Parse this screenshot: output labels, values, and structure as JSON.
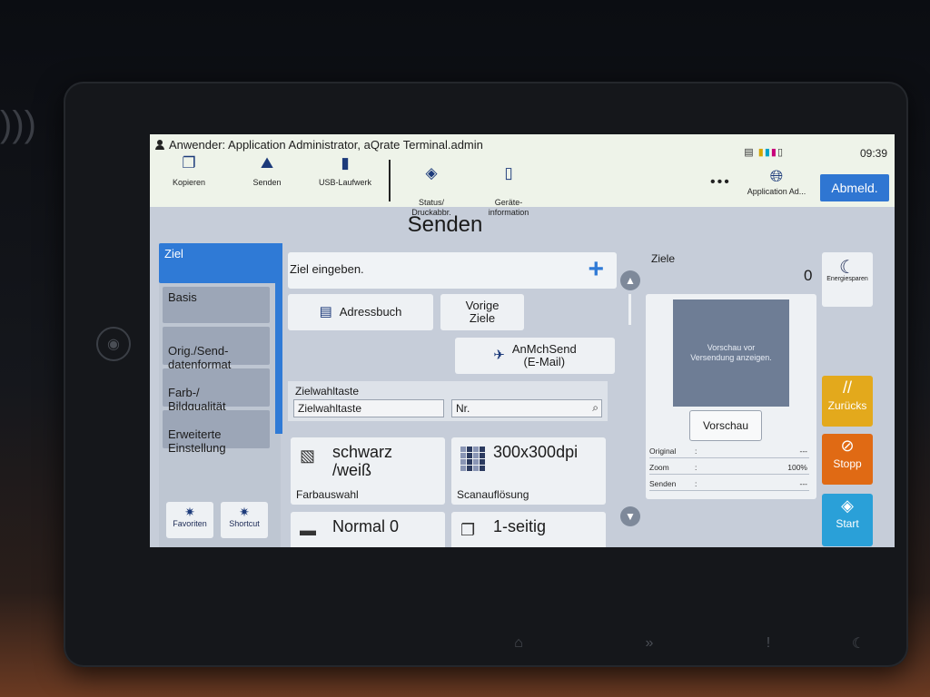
{
  "header": {
    "user_line": "Anwender: Application Administrator, aQrate Terminal.admin",
    "clock": "09:39",
    "toolbar": [
      {
        "label": "Kopieren",
        "icon": "copy-icon"
      },
      {
        "label": "Senden",
        "icon": "send-icon"
      },
      {
        "label": "USB-Laufwerk",
        "icon": "usb-icon"
      },
      {
        "label": "Status/\nDruckabbr.",
        "icon": "status-eye-icon"
      },
      {
        "label": "Geräte-\ninformation",
        "icon": "device-info-icon"
      }
    ],
    "more_label": "•••",
    "admin_label": "Application Ad...",
    "logout_label": "Abmeld."
  },
  "page_title": "Senden",
  "sidebar": {
    "items": [
      {
        "label": "Ziel"
      },
      {
        "label": "Basis"
      },
      {
        "label": "Orig./Send-\ndatenformat"
      },
      {
        "label": "Farb-/\nBildqualität"
      },
      {
        "label": "Erweiterte\nEinstellung"
      }
    ],
    "favorites_label": "Favoriten",
    "shortcut_label": "Shortcut"
  },
  "main": {
    "destination_input_label": "Ziel eingeben.",
    "address_book_label": "Adressbuch",
    "previous_dest_label": "Vorige\nZiele",
    "send_to_me_label": "AnMchSend\n(E-Mail)",
    "quick_dial": {
      "title": "Zielwahltaste",
      "field_label": "Zielwahltaste",
      "number_placeholder": "Nr."
    },
    "tiles": [
      {
        "value": "schwarz\n/weiß",
        "caption": "Farbauswahl",
        "icon": "color-mode-icon"
      },
      {
        "value": "300x300dpi",
        "caption": "Scanauflösung",
        "icon": "dpi-icon"
      },
      {
        "value": "Normal 0",
        "caption": "",
        "icon": "density-icon"
      },
      {
        "value": "1-seitig",
        "caption": "",
        "icon": "duplex-icon"
      }
    ]
  },
  "right": {
    "destinations_label": "Ziele",
    "destinations_count": "0",
    "preview_text": "Vorschau vor\nVersendung anzeigen.",
    "preview_button": "Vorschau",
    "info": [
      {
        "key": "Original",
        "value": "---"
      },
      {
        "key": "Zoom",
        "value": "100%"
      },
      {
        "key": "Senden",
        "value": "---"
      }
    ],
    "energy_label": "Energiesparen",
    "reset_label": "Zurücks",
    "stop_label": "Stopp",
    "start_label": "Start"
  },
  "colors": {
    "accent": "#2f7ad6",
    "reset": "#e3a91c",
    "stop": "#e06a14",
    "start": "#2aa0d8"
  }
}
